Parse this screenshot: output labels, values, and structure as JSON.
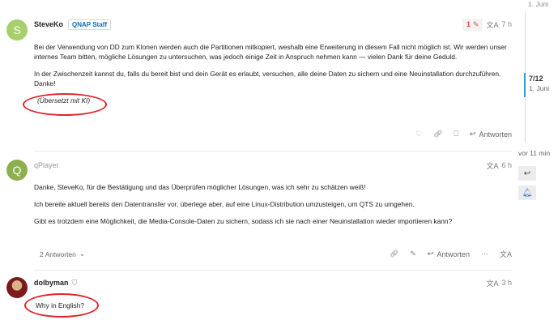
{
  "posts": [
    {
      "avatar_letter": "S",
      "avatar_color": "#a7cf6a",
      "username": "SteveKo",
      "badge": "QNAP Staff",
      "edit_count": "1",
      "time": "7 h",
      "paragraphs": [
        "Bei der Verwendung von DD zum Klonen werden auch die Partitionen mitkopiert, weshalb eine Erweiterung in diesem Fall nicht möglich ist. Wir werden unser internes Team bitten, mögliche Lösungen zu untersuchen, was jedoch einige Zeit in Anspruch nehmen kann — vielen Dank für deine Geduld.",
        "In der Zwischenzeit kannst du, falls du bereit bist und dein Gerät es erlaubt, versuchen, alle deine Daten zu sichern und eine Neuinstallation durchzuführen. Danke!"
      ],
      "translated_note": "(Übersetzt mit KI)",
      "reply_label": "Antworten"
    },
    {
      "avatar_letter": "Q",
      "avatar_color": "#8eaf4e",
      "username": "qPlayer",
      "time": "6 h",
      "paragraphs": [
        "Danke, SteveKo, für die Bestätigung und das Überprüfen möglicher Lösungen, was ich sehr zu schätzen weiß!",
        "Ich bereite aktuell bereits den Datentransfer vor, überlege aber, auf eine Linux-Distribution umzusteigen, um QTS zu umgehen.",
        "Gibt es trotzdem eine Möglichkeit, die Media-Console-Daten zu sichern, sodass ich sie nach einer Neuinstallation wieder importieren kann?"
      ],
      "replies_label": "2 Antworten",
      "reply_label": "Antworten"
    },
    {
      "avatar_color": "#7a1a1a",
      "username": "dolbyman",
      "time": "3 h",
      "paragraphs": [
        "Why in English?"
      ]
    }
  ],
  "timeline": {
    "top_date": "1. Juni",
    "position": "7/12",
    "position_date": "1. Juni",
    "ago": "vor 11 min"
  },
  "colors": {
    "accent": "#3a99d8",
    "highlight_oval": "#e0262d",
    "edit": "#e45735"
  },
  "icons": [
    "pencil-icon",
    "translate-icon",
    "like-icon",
    "link-icon",
    "bookmark-icon",
    "reply-icon",
    "more-icon",
    "chevron-down-icon",
    "shield-icon",
    "bell-icon"
  ]
}
